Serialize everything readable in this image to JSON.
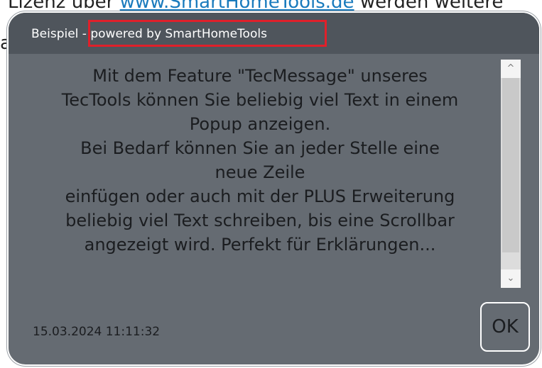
{
  "background": {
    "line1_prefix": "r Lizenz über ",
    "line1_link": "www.SmartHomeTools.de",
    "line1_suffix": " werden weitere",
    "line2": "a"
  },
  "dialog": {
    "title_prefix": "Beispiel",
    "title_suffix": " - powered by SmartHomeTools",
    "message": "Mit dem Feature \"TecMessage\" unseres\nTecTools können Sie beliebig viel Text in einem\nPopup anzeigen.\nBei Bedarf können Sie an jeder Stelle eine\nneue Zeile\neinfügen oder auch mit der PLUS Erweiterung\nbeliebig viel Text schreiben, bis eine Scrollbar\nangezeigt wird. Perfekt für Erklärungen...",
    "timestamp": "15.03.2024 11:11:32",
    "ok_label": "OK",
    "scrollbar": {
      "up_icon": "chevron-up-icon",
      "down_icon": "chevron-down-icon",
      "up_glyph": "^",
      "down_glyph": "⌄"
    },
    "colors": {
      "dialog_bg": "#656b72",
      "header_bg": "#4f555c",
      "highlight": "#e0202a",
      "link": "#1a7bbd"
    }
  }
}
